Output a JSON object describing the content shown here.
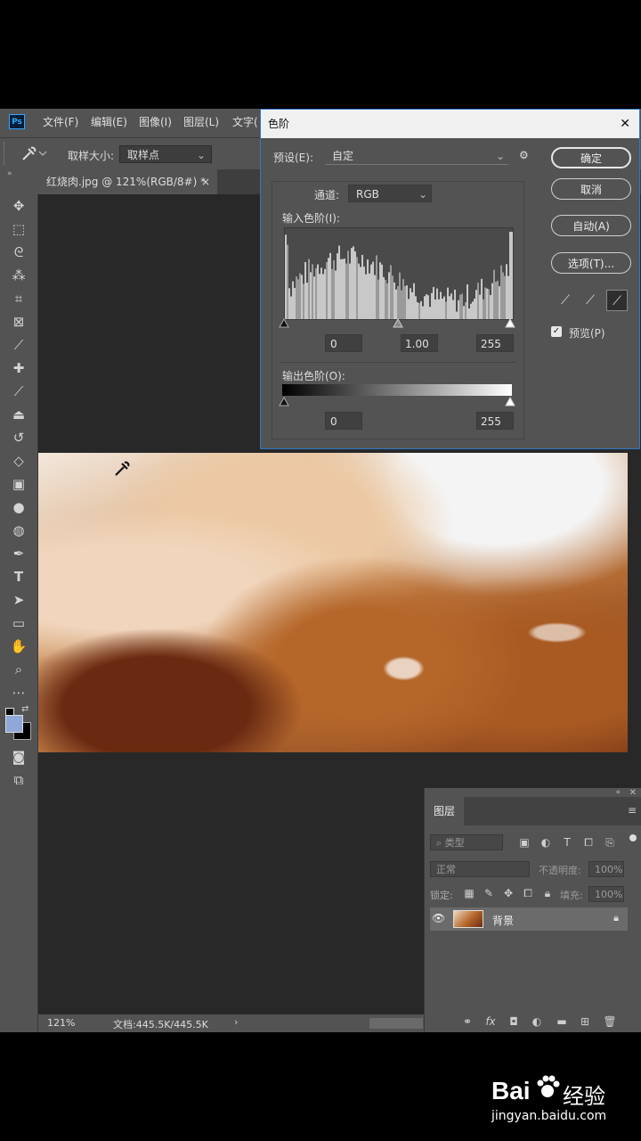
{
  "menubar": {
    "logo": "Ps",
    "items": [
      "文件(F)",
      "编辑(E)",
      "图像(I)",
      "图层(L)",
      "文字("
    ]
  },
  "options": {
    "tool_icon": "eyedropper-icon",
    "sample_size_label": "取样大小:",
    "sample_size_value": "取样点"
  },
  "document_tab": {
    "title": "红烧肉.jpg @ 121%(RGB/8#) *",
    "close": "×"
  },
  "status": {
    "zoom": "121%",
    "doc_info": "文档:445.5K/445.5K",
    "arrow": "›"
  },
  "levels_dialog": {
    "title": "色阶",
    "close": "✕",
    "preset_label": "预设(E):",
    "preset_value": "自定",
    "channel_label": "通道:",
    "channel_value": "RGB",
    "input_levels_label": "输入色阶(I):",
    "input_values": [
      "0",
      "1.00",
      "255"
    ],
    "output_levels_label": "输出色阶(O):",
    "output_values": [
      "0",
      "255"
    ],
    "buttons": {
      "ok": "确定",
      "cancel": "取消",
      "auto": "自动(A)",
      "options": "选项(T)..."
    },
    "preview_label": "预览(P)",
    "preview_checked": true
  },
  "layers_panel": {
    "tab": "图层",
    "filter_label": "类型",
    "blend_mode": "正常",
    "opacity_label": "不透明度:",
    "opacity_value": "100%",
    "lock_label": "锁定:",
    "fill_label": "填充:",
    "fill_value": "100%",
    "layer_name": "背景"
  },
  "watermark": {
    "brand": "Bai",
    "brand2": "经验",
    "url": "jingyan.baidu.com"
  },
  "colors": {
    "ui_bg": "#535353",
    "canvas_bg": "#282828",
    "dialog_border": "#2f77c6"
  }
}
